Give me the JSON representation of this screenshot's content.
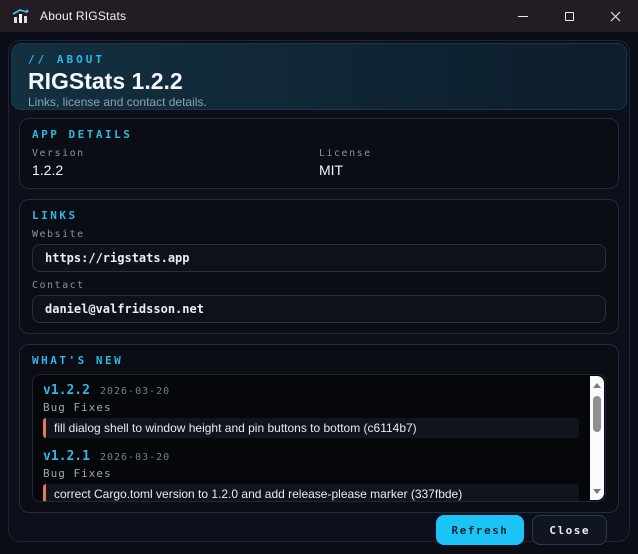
{
  "window": {
    "title": "About RIGStats",
    "app_icon": "bar-chart-trend-icon",
    "controls": {
      "minimize": "minimize-icon",
      "maximize": "maximize-icon",
      "close": "close-icon"
    }
  },
  "header": {
    "eyebrow": "// ABOUT",
    "title": "RIGStats 1.2.2",
    "subtitle": "Links, license and contact details."
  },
  "app_details": {
    "heading": "APP DETAILS",
    "fields": [
      {
        "label": "Version",
        "value": "1.2.2"
      },
      {
        "label": "License",
        "value": "MIT"
      }
    ]
  },
  "links": {
    "heading": "LINKS",
    "fields": [
      {
        "label": "Website",
        "value": "https://rigstats.app"
      },
      {
        "label": "Contact",
        "value": "daniel@valfridsson.net"
      }
    ]
  },
  "whats_new": {
    "heading": "WHAT'S NEW",
    "entries": [
      {
        "version": "v1.2.2",
        "date": "2026-03-20",
        "section": "Bug Fixes",
        "items": [
          "fill dialog shell to window height and pin buttons to bottom (c6114b7)"
        ]
      },
      {
        "version": "v1.2.1",
        "date": "2026-03-20",
        "section": "Bug Fixes",
        "items": [
          "correct Cargo.toml version to 1.2.0 and add release-please marker (337fbde)"
        ]
      }
    ]
  },
  "footer": {
    "refresh_label": "Refresh",
    "close_label": "Close"
  },
  "colors": {
    "accent": "#2db8e8",
    "accent_button": "#1cc3f7",
    "accent_button_text": "#0b2531",
    "changelog_marker": "#e4785c",
    "titlebar_bg": "#231c23",
    "page_bg": "#0a0d15",
    "banner_from": "#133040",
    "banner_to": "#0d1d2b"
  }
}
